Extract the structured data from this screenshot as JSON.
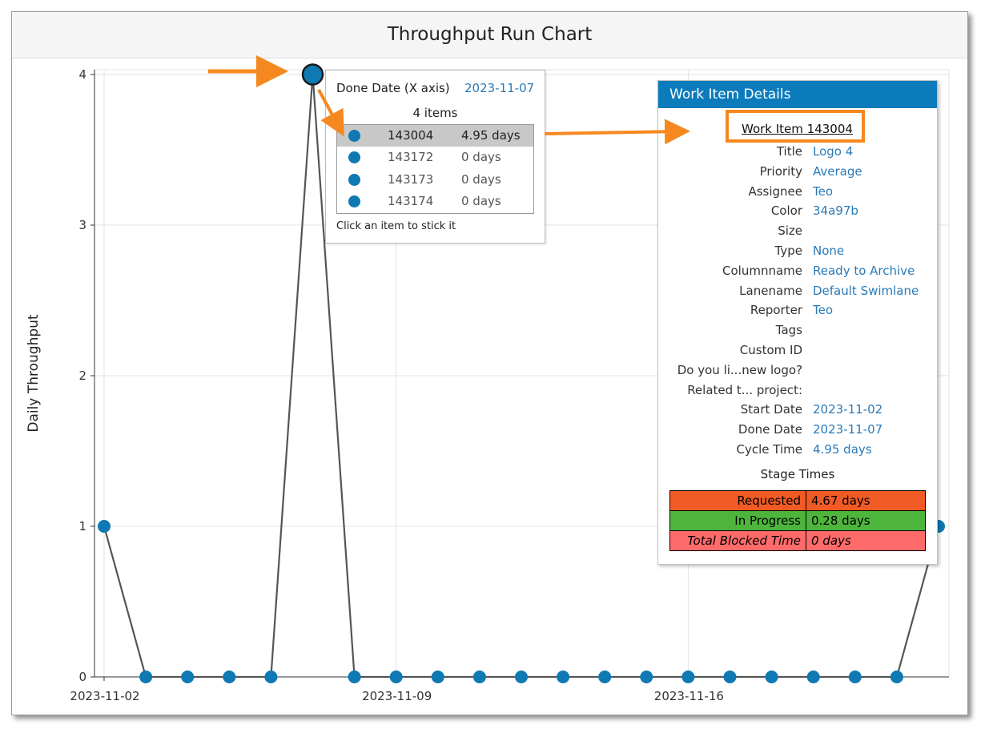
{
  "chart_data": {
    "type": "line",
    "title": "Throughput Run Chart",
    "xlabel": "",
    "ylabel": "Daily Throughput",
    "x": [
      "2023-11-02",
      "2023-11-03",
      "2023-11-04",
      "2023-11-05",
      "2023-11-06",
      "2023-11-07",
      "2023-11-08",
      "2023-11-09",
      "2023-11-10",
      "2023-11-11",
      "2023-11-12",
      "2023-11-13",
      "2023-11-14",
      "2023-11-15",
      "2023-11-16",
      "2023-11-17",
      "2023-11-18",
      "2023-11-19",
      "2023-11-20",
      "2023-11-21",
      "2023-11-22"
    ],
    "values": [
      1,
      0,
      0,
      0,
      0,
      4,
      0,
      0,
      0,
      0,
      0,
      0,
      0,
      0,
      0,
      0,
      0,
      0,
      0,
      0,
      1
    ],
    "x_ticks": [
      "2023-11-02",
      "2023-11-09",
      "2023-11-16"
    ],
    "y_ticks": [
      "0",
      "1",
      "2",
      "3",
      "4"
    ],
    "ylim": [
      0,
      4
    ],
    "grid": true,
    "colors": {
      "line": "#555555",
      "point": "#0e79b2",
      "highlight_outline": "#1a1a1a"
    },
    "highlighted_point": "2023-11-07"
  },
  "tooltip": {
    "header_label": "Done Date (X axis)",
    "header_value": "2023-11-07",
    "count": "4 items",
    "items": [
      {
        "id": "143004",
        "days": "4.95 days",
        "selected": true
      },
      {
        "id": "143172",
        "days": "0 days"
      },
      {
        "id": "143173",
        "days": "0 days"
      },
      {
        "id": "143174",
        "days": "0 days"
      }
    ],
    "footer": "Click an item to stick it"
  },
  "details": {
    "title": "Work Item Details",
    "link": "Work Item 143004",
    "fields": [
      {
        "key": "Title",
        "value": "Logo 4"
      },
      {
        "key": "Priority",
        "value": "Average"
      },
      {
        "key": "Assignee",
        "value": "Teo"
      },
      {
        "key": "Color",
        "value": "34a97b"
      },
      {
        "key": "Size",
        "value": ""
      },
      {
        "key": "Type",
        "value": "None"
      },
      {
        "key": "Columnname",
        "value": "Ready to Archive"
      },
      {
        "key": "Lanename",
        "value": "Default Swimlane"
      },
      {
        "key": "Reporter",
        "value": "Teo"
      },
      {
        "key": "Tags",
        "value": ""
      },
      {
        "key": "Custom ID",
        "value": ""
      },
      {
        "key": "Do you li...new logo?",
        "value": ""
      },
      {
        "key": "Related t... project:",
        "value": ""
      },
      {
        "key": "Start Date",
        "value": "2023-11-02"
      },
      {
        "key": "Done Date",
        "value": "2023-11-07"
      },
      {
        "key": "Cycle Time",
        "value": "4.95 days"
      }
    ],
    "stage_title": "Stage Times",
    "stages": [
      {
        "name": "Requested",
        "value": "4.67 days",
        "color": "#f05a24"
      },
      {
        "name": "In Progress",
        "value": "0.28 days",
        "color": "#4db53c"
      },
      {
        "name": "Total Blocked Time",
        "value": "0 days",
        "color": "#ff6a6a"
      }
    ]
  },
  "annotation_color": "#f5891f"
}
